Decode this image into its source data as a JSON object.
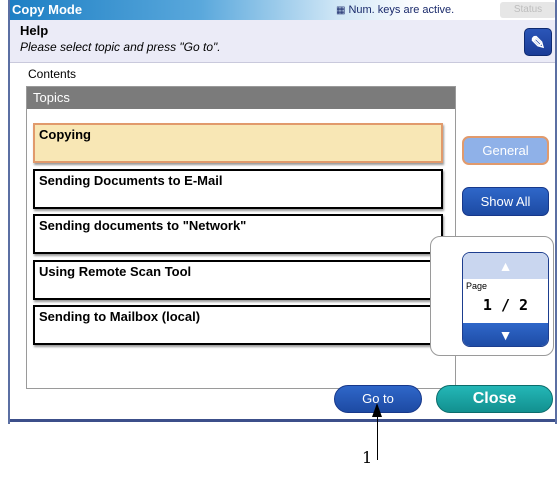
{
  "header": {
    "mode_title": "Copy Mode",
    "num_keys_icon": "grid-icon",
    "num_keys_text": "Num. keys are active.",
    "status_label": "Status"
  },
  "help": {
    "title": "Help",
    "instruction": "Please select topic and press \"Go to\".",
    "wrench_icon": "wrench-icon"
  },
  "contents_label": "Contents",
  "topics": {
    "header": "Topics",
    "items": [
      {
        "label": "Copying",
        "selected": true
      },
      {
        "label": "Sending Documents to E-Mail",
        "selected": false
      },
      {
        "label": "Sending documents to \"Network\"",
        "selected": false
      },
      {
        "label": "Using Remote Scan Tool",
        "selected": false
      },
      {
        "label": "Sending to Mailbox (local)",
        "selected": false
      }
    ]
  },
  "side_buttons": {
    "general": "General",
    "show_all": "Show All"
  },
  "pager": {
    "label": "Page",
    "value": "1 / 2"
  },
  "footer": {
    "goto": "Go to",
    "close": "Close"
  },
  "callout": {
    "number": "1"
  },
  "colors": {
    "accent_blue": "#1d4aa3",
    "selected_fill": "#f8e7b5",
    "selected_border": "#e19a6c",
    "close_teal": "#12908f"
  }
}
